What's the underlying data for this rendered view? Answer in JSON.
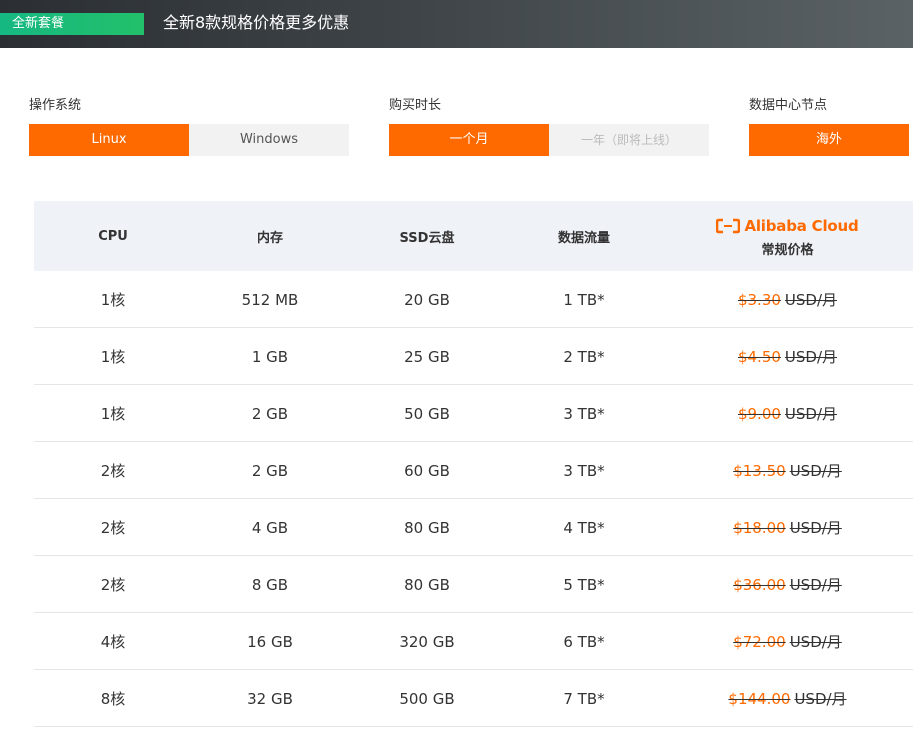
{
  "banner": {
    "badge": "全新套餐",
    "title": "全新8款规格价格更多优惠"
  },
  "options": {
    "os": {
      "label": "操作系统",
      "choices": [
        "Linux",
        "Windows"
      ],
      "selected": "Linux"
    },
    "duration": {
      "label": "购买时长",
      "choices": [
        "一个月",
        "一年（即将上线）"
      ],
      "selected": "一个月"
    },
    "datacenter": {
      "label": "数据中心节点",
      "choices": [
        "海外"
      ],
      "selected": "海外"
    }
  },
  "table": {
    "headers": [
      "CPU",
      "内存",
      "SSD云盘",
      "数据流量"
    ],
    "brand_logo_text": "Alibaba Cloud",
    "brand_sub": "常规价格",
    "price_unit": "USD/月",
    "rows": [
      {
        "cpu": "1核",
        "mem": "512 MB",
        "ssd": "20 GB",
        "traffic": "1 TB*",
        "price": "$3.30"
      },
      {
        "cpu": "1核",
        "mem": "1 GB",
        "ssd": "25 GB",
        "traffic": "2 TB*",
        "price": "$4.50"
      },
      {
        "cpu": "1核",
        "mem": "2 GB",
        "ssd": "50 GB",
        "traffic": "3 TB*",
        "price": "$9.00"
      },
      {
        "cpu": "2核",
        "mem": "2 GB",
        "ssd": "60 GB",
        "traffic": "3 TB*",
        "price": "$13.50"
      },
      {
        "cpu": "2核",
        "mem": "4 GB",
        "ssd": "80 GB",
        "traffic": "4 TB*",
        "price": "$18.00"
      },
      {
        "cpu": "2核",
        "mem": "8 GB",
        "ssd": "80 GB",
        "traffic": "5 TB*",
        "price": "$36.00"
      },
      {
        "cpu": "4核",
        "mem": "16 GB",
        "ssd": "320 GB",
        "traffic": "6 TB*",
        "price": "$72.00"
      },
      {
        "cpu": "8核",
        "mem": "32 GB",
        "ssd": "500 GB",
        "traffic": "7 TB*",
        "price": "$144.00"
      }
    ]
  },
  "colors": {
    "accent": "#ff6a00",
    "badge": "#22c06a",
    "header_bg": "#eff3f8"
  }
}
